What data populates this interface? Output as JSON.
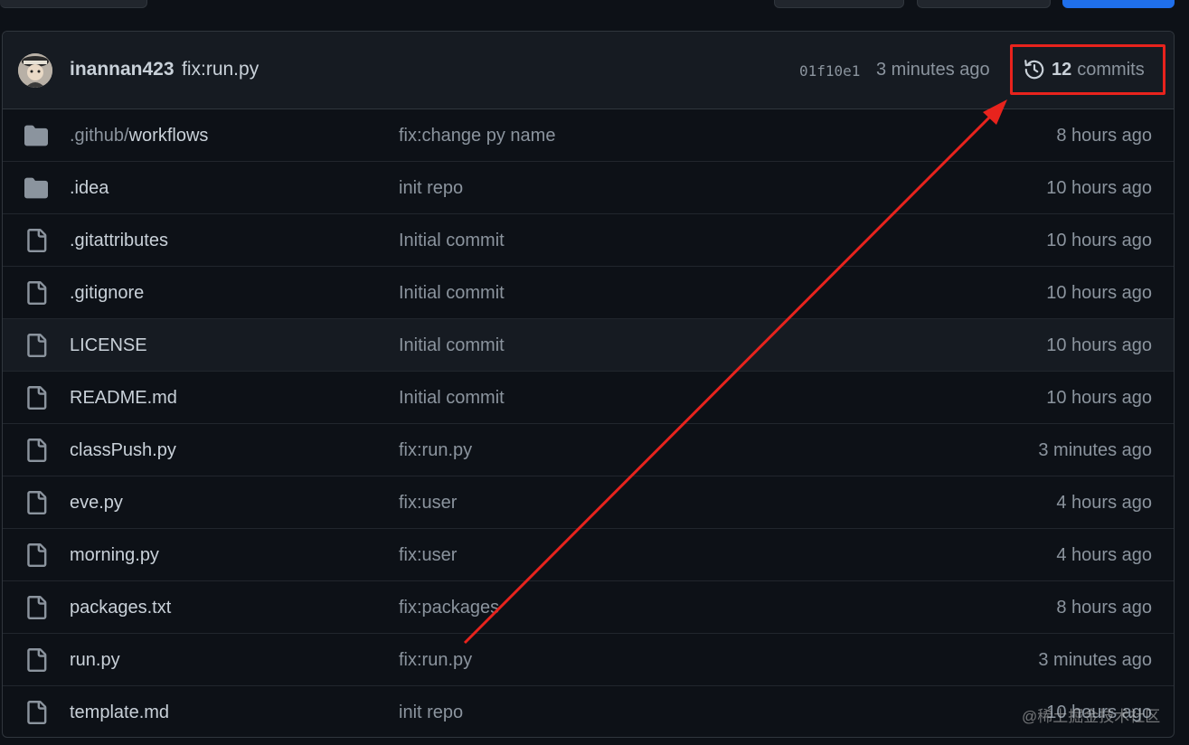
{
  "latest_commit": {
    "author": "inannan423",
    "message": "fix:run.py",
    "sha": "01f10e1",
    "time": "3 minutes ago",
    "commits_count": "12",
    "commits_label": "commits"
  },
  "files": [
    {
      "type": "folder",
      "name_prefix": ".github/",
      "name": "workflows",
      "message": "fix:change py name",
      "time": "8 hours ago"
    },
    {
      "type": "folder",
      "name_prefix": "",
      "name": ".idea",
      "message": "init repo",
      "time": "10 hours ago"
    },
    {
      "type": "file",
      "name_prefix": "",
      "name": ".gitattributes",
      "message": "Initial commit",
      "time": "10 hours ago"
    },
    {
      "type": "file",
      "name_prefix": "",
      "name": ".gitignore",
      "message": "Initial commit",
      "time": "10 hours ago"
    },
    {
      "type": "file",
      "name_prefix": "",
      "name": "LICENSE",
      "message": "Initial commit",
      "time": "10 hours ago"
    },
    {
      "type": "file",
      "name_prefix": "",
      "name": "README.md",
      "message": "Initial commit",
      "time": "10 hours ago"
    },
    {
      "type": "file",
      "name_prefix": "",
      "name": "classPush.py",
      "message": "fix:run.py",
      "time": "3 minutes ago"
    },
    {
      "type": "file",
      "name_prefix": "",
      "name": "eve.py",
      "message": "fix:user",
      "time": "4 hours ago"
    },
    {
      "type": "file",
      "name_prefix": "",
      "name": "morning.py",
      "message": "fix:user",
      "time": "4 hours ago"
    },
    {
      "type": "file",
      "name_prefix": "",
      "name": "packages.txt",
      "message": "fix:packages",
      "time": "8 hours ago"
    },
    {
      "type": "file",
      "name_prefix": "",
      "name": "run.py",
      "message": "fix:run.py",
      "time": "3 minutes ago"
    },
    {
      "type": "file",
      "name_prefix": "",
      "name": "template.md",
      "message": "init repo",
      "time": "10 hours ago"
    }
  ],
  "watermark": "@稀土掘金技术社区",
  "colors": {
    "background": "#0d1117",
    "header_bg": "#161b22",
    "border": "#30363d",
    "text": "#c9d1d9",
    "muted": "#8b949e",
    "annotation_red": "#e8231d",
    "primary_button": "#1f6feb"
  }
}
